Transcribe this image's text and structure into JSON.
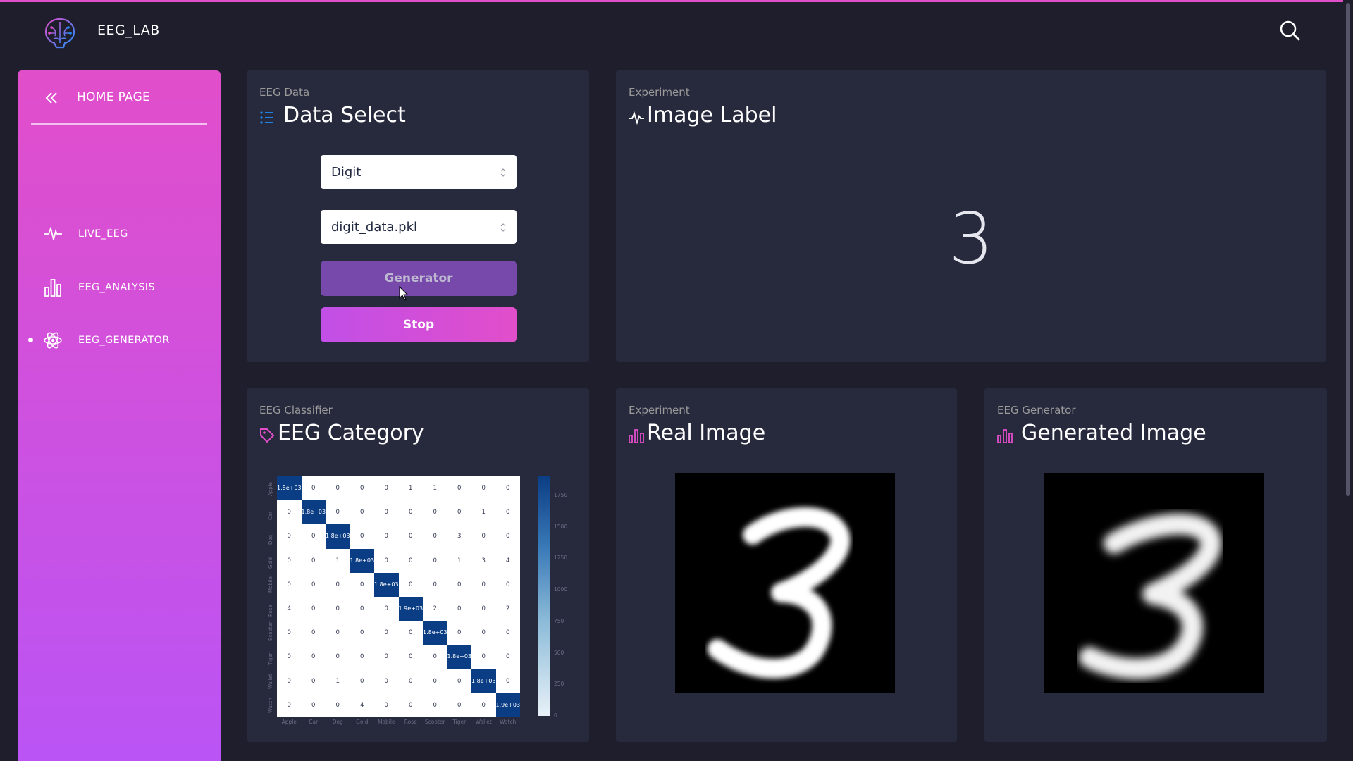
{
  "app": {
    "title": "EEG_LAB"
  },
  "sidebar": {
    "header": "HOME PAGE",
    "items": [
      {
        "label": "LIVE_EEG",
        "icon": "pulse-icon",
        "active": false
      },
      {
        "label": "EEG_ANALYSIS",
        "icon": "bar-chart-icon",
        "active": false
      },
      {
        "label": "EEG_GENERATOR",
        "icon": "atom-icon",
        "active": true
      }
    ]
  },
  "colors": {
    "accent": "#e14eca",
    "accent2": "#ba54f5",
    "card": "#27293d",
    "background": "#1e1e2d",
    "heatmap_dark": "#0b3d84"
  },
  "data_select": {
    "category": "EEG Data",
    "title": "Data Select",
    "select_type": "Digit",
    "select_file": "digit_data.pkl",
    "generator_label": "Generator",
    "stop_label": "Stop"
  },
  "image_label": {
    "category": "Experiment",
    "title": "Image Label",
    "value": "3"
  },
  "eeg_category": {
    "category": "EEG Classifier",
    "title": "EEG Category"
  },
  "real_image": {
    "category": "Experiment",
    "title": "Real Image",
    "digit": "3"
  },
  "generated_image": {
    "category": "EEG Generator",
    "title": "Generated Image",
    "digit": "3"
  },
  "chart_data": {
    "type": "heatmap",
    "categories": [
      "Apple",
      "Car",
      "Dog",
      "Gold",
      "Mobile",
      "Rose",
      "Scooter",
      "Tiger",
      "Wallet",
      "Watch"
    ],
    "cells": [
      [
        "1.8e+03",
        "0",
        "0",
        "0",
        "0",
        "1",
        "1",
        "0",
        "0",
        "0"
      ],
      [
        "0",
        "1.8e+03",
        "0",
        "0",
        "0",
        "0",
        "0",
        "0",
        "1",
        "0"
      ],
      [
        "0",
        "0",
        "1.8e+03",
        "0",
        "0",
        "0",
        "0",
        "3",
        "0",
        "0"
      ],
      [
        "0",
        "0",
        "1",
        "1.8e+03",
        "0",
        "0",
        "0",
        "1",
        "3",
        "4"
      ],
      [
        "0",
        "0",
        "0",
        "0",
        "1.8e+03",
        "0",
        "0",
        "0",
        "0",
        "0"
      ],
      [
        "4",
        "0",
        "0",
        "0",
        "0",
        "1.9e+03",
        "2",
        "0",
        "0",
        "2"
      ],
      [
        "0",
        "0",
        "0",
        "0",
        "0",
        "0",
        "1.8e+03",
        "0",
        "0",
        "0"
      ],
      [
        "0",
        "0",
        "0",
        "0",
        "0",
        "0",
        "0",
        "1.8e+03",
        "0",
        "0"
      ],
      [
        "0",
        "0",
        "1",
        "0",
        "0",
        "0",
        "0",
        "0",
        "1.8e+03",
        "0"
      ],
      [
        "0",
        "0",
        "0",
        "4",
        "0",
        "0",
        "0",
        "0",
        "0",
        "1.9e+03"
      ]
    ],
    "colorbar_ticks": [
      "1750",
      "1500",
      "1250",
      "1000",
      "750",
      "500",
      "250",
      "0"
    ],
    "colorbar_range": [
      0,
      1900
    ]
  }
}
